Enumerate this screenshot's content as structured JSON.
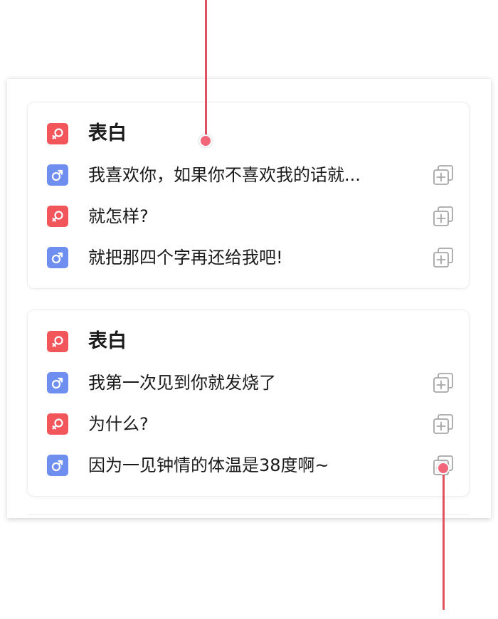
{
  "colors": {
    "female": "#f2555a",
    "male": "#6f8ff0",
    "callout": "#e0505f",
    "copy_icon": "#a6a6a6"
  },
  "cards": [
    {
      "title": "表白",
      "title_icon": "female-icon",
      "lines": [
        {
          "gender": "male",
          "icon": "male-icon",
          "text": "我喜欢你，如果你不喜欢我的话就..."
        },
        {
          "gender": "female",
          "icon": "female-icon",
          "text": "就怎样?"
        },
        {
          "gender": "male",
          "icon": "male-icon",
          "text": "就把那四个字再还给我吧!"
        }
      ]
    },
    {
      "title": "表白",
      "title_icon": "female-icon",
      "lines": [
        {
          "gender": "male",
          "icon": "male-icon",
          "text": "我第一次见到你就发烧了"
        },
        {
          "gender": "female",
          "icon": "female-icon",
          "text": "为什么?"
        },
        {
          "gender": "male",
          "icon": "male-icon",
          "text": "因为一见钟情的体温是38度啊~"
        }
      ]
    }
  ]
}
